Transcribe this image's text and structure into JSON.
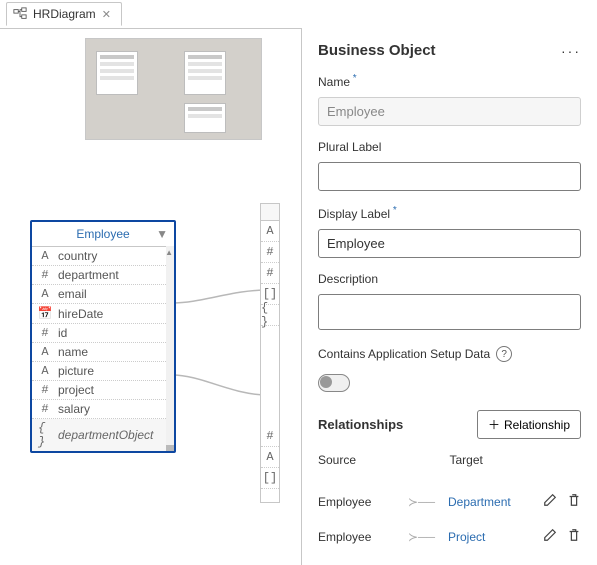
{
  "tab": {
    "icon": "diagram-icon",
    "label": "HRDiagram"
  },
  "entity": {
    "title": "Employee",
    "fields": [
      {
        "icon": "A",
        "name": "country"
      },
      {
        "icon": "#",
        "name": "department"
      },
      {
        "icon": "A",
        "name": "email"
      },
      {
        "icon": "📅",
        "name": "hireDate"
      },
      {
        "icon": "#",
        "name": "id"
      },
      {
        "icon": "A",
        "name": "name"
      },
      {
        "icon": "A",
        "name": "picture"
      },
      {
        "icon": "#",
        "name": "project"
      },
      {
        "icon": "#",
        "name": "salary"
      },
      {
        "icon": "{ }",
        "name": "departmentObject"
      }
    ]
  },
  "entity2_icons": [
    "A",
    "#",
    "#",
    "[]",
    "{ }",
    "",
    "#",
    "A",
    "[]"
  ],
  "panel": {
    "title": "Business Object",
    "name_label": "Name",
    "name_value": "Employee",
    "plural_label": "Plural Label",
    "plural_value": "",
    "display_label": "Display Label",
    "display_value": "Employee",
    "description_label": "Description",
    "description_value": "",
    "setup_label": "Contains Application Setup Data",
    "relationships_label": "Relationships",
    "relationship_btn": "Relationship",
    "col_source": "Source",
    "col_target": "Target",
    "rows": [
      {
        "source": "Employee",
        "target": "Department"
      },
      {
        "source": "Employee",
        "target": "Project"
      }
    ]
  }
}
